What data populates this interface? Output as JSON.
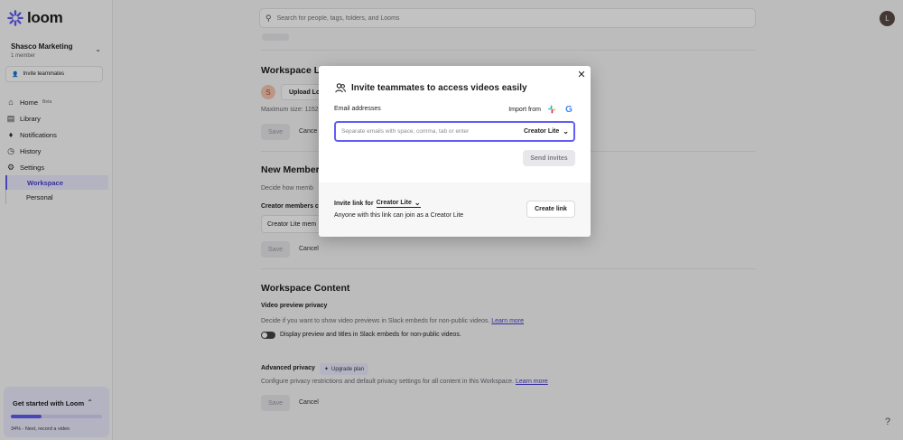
{
  "app": {
    "brand": "loom"
  },
  "sidebar": {
    "workspace_name": "Shasco Marketing",
    "workspace_members": "1 member",
    "invite_label": "Invite teammates",
    "nav": [
      {
        "label": "Home",
        "badge": "Beta"
      },
      {
        "label": "Library"
      },
      {
        "label": "Notifications"
      },
      {
        "label": "History"
      },
      {
        "label": "Settings"
      }
    ],
    "settings_sub": [
      {
        "label": "Workspace",
        "active": true
      },
      {
        "label": "Personal"
      }
    ],
    "get_started": {
      "title": "Get started with Loom",
      "progress_percent": 34,
      "status": "34% - Next, record a video"
    }
  },
  "header": {
    "search_placeholder": "Search for people, tags, folders, and Looms",
    "avatar_initial": "L"
  },
  "main": {
    "workspace_logo": {
      "title": "Workspace Lo",
      "avatar_initial": "S",
      "upload_label": "Upload Lo",
      "max_size": "Maximum size: 1152",
      "save": "Save",
      "cancel": "Cance"
    },
    "new_members": {
      "title": "New Membersh",
      "desc": "Decide how memb",
      "field_label": "Creator members c",
      "field_value": "Creator Lite mem",
      "save": "Save",
      "cancel": "Cancel"
    },
    "workspace_content": {
      "title": "Workspace Content",
      "video_preview_label": "Video preview privacy",
      "video_preview_desc": "Decide if you want to show video previews in Slack embeds for non-public videos.",
      "learn_more": "Learn more",
      "toggle_label": "Display preview and titles in Slack embeds for non-public videos.",
      "advanced_label": "Advanced privacy",
      "upgrade_label": "Upgrade plan",
      "advanced_desc": "Configure privacy restrictions and default privacy settings for all content in this Workspace.",
      "learn_more_2": "Learn more",
      "save": "Save",
      "cancel": "Cancel"
    }
  },
  "modal": {
    "title": "Invite teammates to access videos easily",
    "email_label": "Email addresses",
    "import_label": "Import from",
    "email_placeholder": "Separate emails with space, comma, tab or enter",
    "role": "Creator Lite",
    "send_label": "Send invites",
    "link_for_label": "Invite link for",
    "link_role": "Creator Lite",
    "link_desc": "Anyone with this link can join as a Creator Lite",
    "create_link_label": "Create link"
  },
  "colors": {
    "accent": "#625df5",
    "overlay": "rgba(0,0,0,0.24)"
  }
}
